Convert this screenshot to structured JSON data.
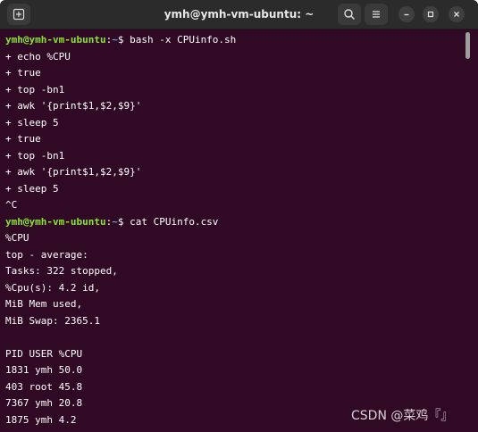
{
  "window": {
    "title": "ymh@ymh-vm-ubuntu: ~"
  },
  "icons": {
    "new_tab": "new-tab-icon",
    "search": "search-icon",
    "menu": "hamburger-menu-icon",
    "minimize": "minimize-icon",
    "maximize": "maximize-icon",
    "close": "close-icon"
  },
  "colors": {
    "terminal_bg": "#300a24",
    "prompt_user": "#8ae234",
    "prompt_path": "#729fcf"
  },
  "prompt": {
    "user_host": "ymh@ymh-vm-ubuntu",
    "path": "~"
  },
  "terminal": {
    "cmd1": "bash -x CPUinfo.sh",
    "out": [
      "+ echo %CPU",
      "+ true",
      "+ top -bn1",
      "+ awk '{print$1,$2,$9}'",
      "+ sleep 5",
      "+ true",
      "+ top -bn1",
      "+ awk '{print$1,$2,$9}'",
      "+ sleep 5",
      "^C"
    ],
    "cmd2": "cat CPUinfo.csv",
    "csv": [
      "%CPU",
      "top - average:",
      "Tasks: 322 stopped,",
      "%Cpu(s): 4.2 id,",
      "MiB Mem used,",
      "MiB Swap: 2365.1",
      "",
      "PID USER %CPU",
      "1831 ymh 50.0",
      "403 root 45.8",
      "7367 ymh 20.8",
      "1875 ymh 4.2"
    ]
  },
  "watermark": "CSDN @菜鸡『』"
}
